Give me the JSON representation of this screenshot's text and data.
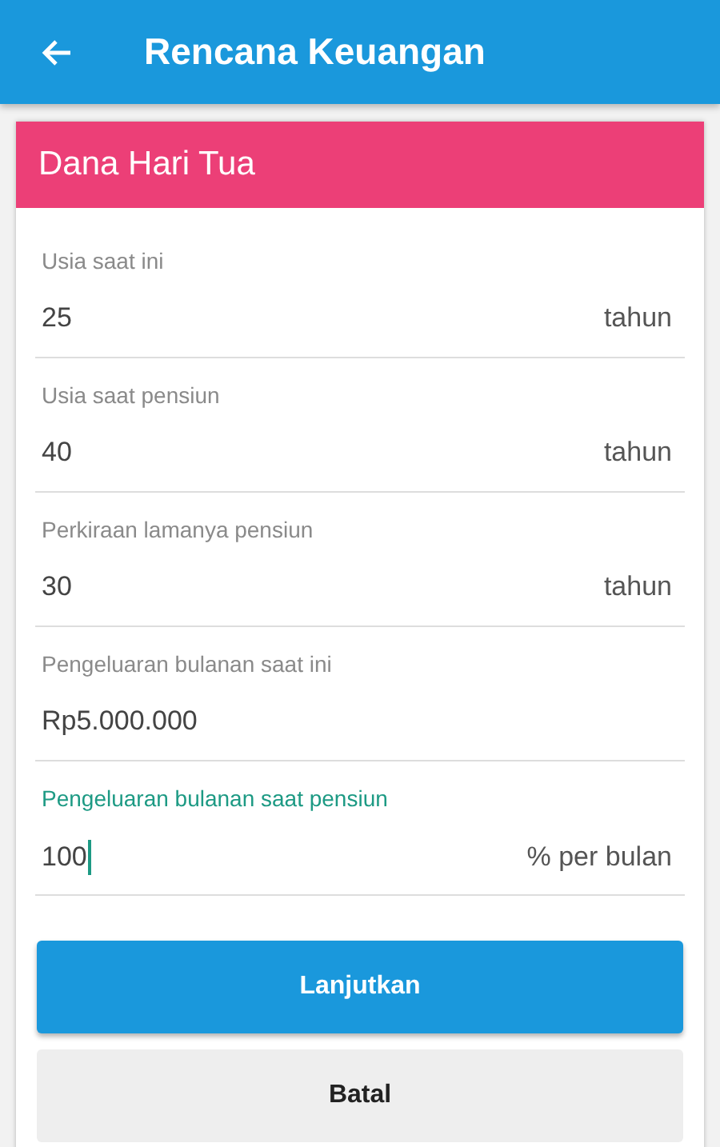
{
  "app_bar": {
    "title": "Rencana Keuangan"
  },
  "card": {
    "title": "Dana Hari Tua",
    "fields": [
      {
        "label": "Usia saat ini",
        "value": "25",
        "unit": "tahun",
        "focused": false
      },
      {
        "label": "Usia saat pensiun",
        "value": "40",
        "unit": "tahun",
        "focused": false
      },
      {
        "label": "Perkiraan lamanya pensiun",
        "value": "30",
        "unit": "tahun",
        "focused": false
      },
      {
        "label": "Pengeluaran bulanan saat ini",
        "value": "Rp5.000.000",
        "focused": false
      },
      {
        "label": "Pengeluaran bulanan saat pensiun",
        "value": "100",
        "unit": "% per bulan",
        "focused": true
      }
    ]
  },
  "buttons": [
    {
      "label": "Lanjutkan",
      "kind": "primary"
    },
    {
      "label": "Batal",
      "kind": "secondary"
    }
  ]
}
